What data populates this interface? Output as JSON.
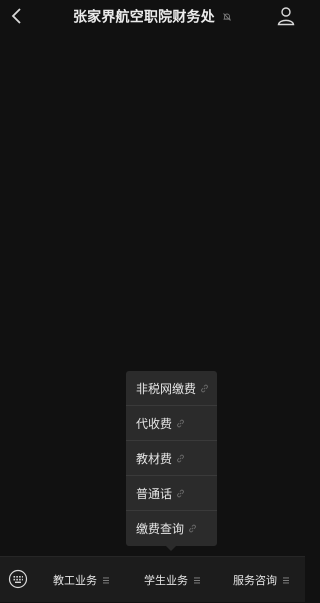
{
  "header": {
    "title": "张家界航空职院财务处"
  },
  "popup": {
    "items": [
      {
        "label": "非税网缴费"
      },
      {
        "label": "代收费"
      },
      {
        "label": "教材费"
      },
      {
        "label": "普通话"
      },
      {
        "label": "缴费查询"
      }
    ]
  },
  "bottom_menu": {
    "items": [
      {
        "label": "教工业务"
      },
      {
        "label": "学生业务"
      },
      {
        "label": "服务咨询"
      }
    ]
  },
  "icons": {
    "back": "chevron-left-icon",
    "mute": "mute-icon",
    "profile": "person-icon",
    "link": "link-icon",
    "keyboard": "keyboard-icon",
    "submenu": "hamburger-icon"
  },
  "colors": {
    "background": "#111111",
    "popup": "#2b2b2b",
    "bottom_bar": "#1c1c1c",
    "text": "#e6e6e6"
  }
}
